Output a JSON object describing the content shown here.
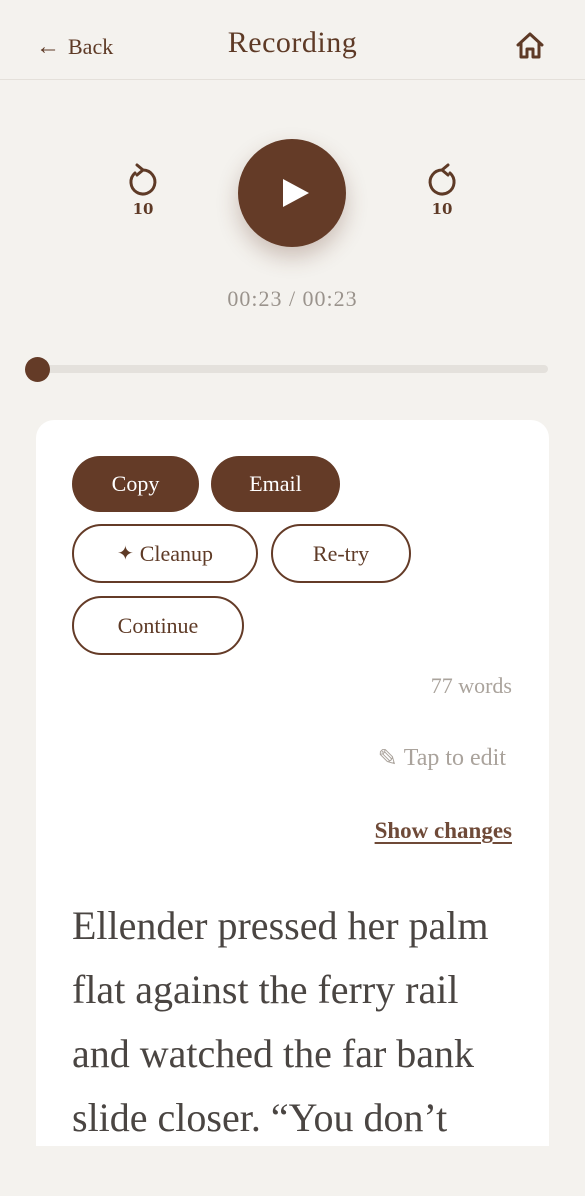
{
  "header": {
    "back_label": "Back",
    "title": "Recording"
  },
  "player": {
    "rewind_seconds": "10",
    "forward_seconds": "10",
    "time_display": "00:23 / 00:23",
    "progress": 0
  },
  "actions": {
    "copy": "Copy",
    "email": "Email",
    "cleanup": "Cleanup",
    "retry": "Re-try",
    "continue": "Continue"
  },
  "meta": {
    "word_count": "77 words",
    "tap_to_edit": "Tap to edit",
    "show_changes": "Show changes"
  },
  "transcript": {
    "text": "Ellender pressed her palm flat against the ferry rail and watched the far bank slide closer. “You don’t"
  },
  "colors": {
    "accent": "#643b27",
    "background": "#f4f2ee",
    "muted": "#aaa39c"
  },
  "icons": {
    "back": "left-arrow-icon",
    "home": "home-icon",
    "rewind": "rewind-10-icon",
    "forward": "forward-10-icon",
    "play": "play-icon",
    "cleanup": "sparkle-icon",
    "edit": "pencil-icon"
  }
}
